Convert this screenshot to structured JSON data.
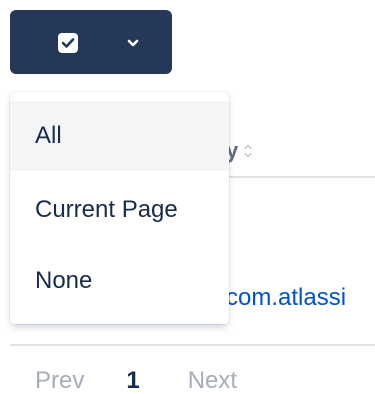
{
  "select_button": {
    "checkbox_icon": "checkbox-checked-icon",
    "chevron_icon": "chevron-down-icon",
    "color": "#253858"
  },
  "dropdown": {
    "items": [
      {
        "label": "All",
        "highlighted": true
      },
      {
        "label": "Current Page",
        "highlighted": false
      },
      {
        "label": "None",
        "highlighted": false
      }
    ]
  },
  "table": {
    "partial_header_text": "y",
    "row_link_text": "com.atlassi",
    "link_color": "#0052cc"
  },
  "pagination": {
    "prev_label": "Prev",
    "current_page": "1",
    "next_label": "Next"
  }
}
